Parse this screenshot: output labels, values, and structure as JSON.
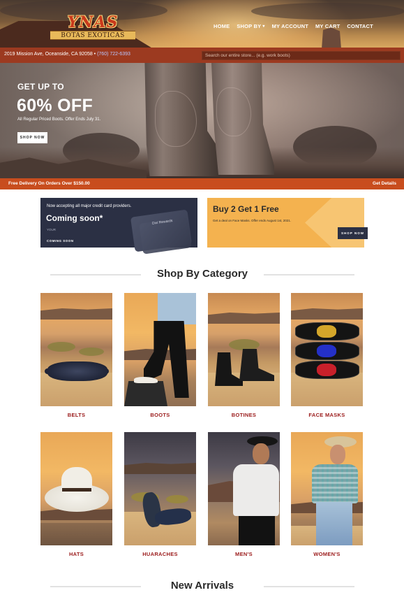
{
  "header": {
    "logo_name": "YNAS",
    "logo_tagline": "BOTAS EXOTICAS",
    "nav": [
      {
        "label": "HOME"
      },
      {
        "label": "SHOP BY",
        "has_dropdown": true
      },
      {
        "label": "MY ACCOUNT"
      },
      {
        "label": "MY CART"
      },
      {
        "label": "CONTACT"
      }
    ]
  },
  "infobar": {
    "address": "2019 Mission Ave, Oceanside, CA 92058 • ",
    "phone": "(760) 722-6393",
    "search_placeholder": "Search our entire store... (e.g. work boots)"
  },
  "hero": {
    "line1": "GET UP TO",
    "line2": "60% OFF",
    "subtitle": "All Regular Priced Boots. Offer Ends July 31.",
    "button": "SHOP NOW"
  },
  "delivery": {
    "text": "Free Delivery On Orders Over $150.00",
    "link": "Get Details"
  },
  "promos": {
    "credit": {
      "kicker": "Now accepting all major credit card providers.",
      "title": "Coming soon*",
      "mini": "YOUR",
      "badge": "COMING SOON",
      "card_text": "Divi Rewards"
    },
    "b2g1": {
      "title": "Buy 2 Get 1 Free",
      "subtitle": "Get a deal on Face Masks. Offer ends August 1st, 2021.",
      "button": "SHOP NOW"
    }
  },
  "shop_by_category": {
    "title": "Shop By Category",
    "items": [
      {
        "label": "BELTS"
      },
      {
        "label": "BOOTS"
      },
      {
        "label": "BOTINES"
      },
      {
        "label": "FACE MASKS"
      },
      {
        "label": "HATS"
      },
      {
        "label": "HUARACHES"
      },
      {
        "label": "MEN'S"
      },
      {
        "label": "WOMEN'S"
      }
    ]
  },
  "new_arrivals": {
    "title": "New Arrivals"
  },
  "colors": {
    "brand_red": "#9c3a20",
    "delivery_orange": "#c84d1e",
    "category_label": "#9b1b1b",
    "promo_navy": "#2b3044",
    "promo_yellow": "#f4b24f"
  }
}
